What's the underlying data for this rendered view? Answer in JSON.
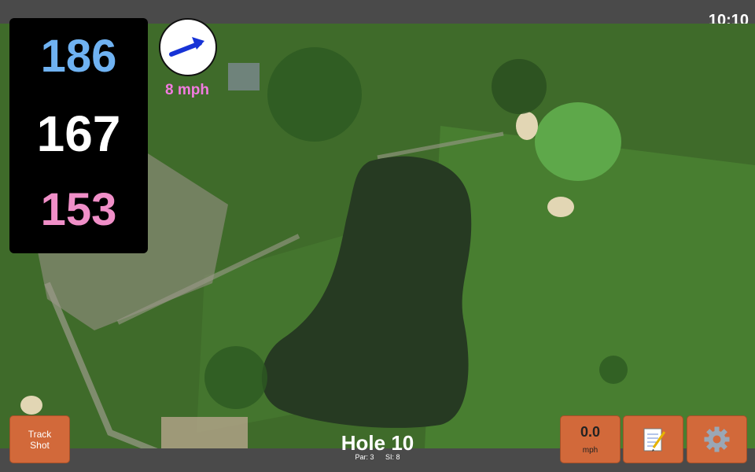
{
  "status": {
    "time": "10:10"
  },
  "distances": {
    "back": "186",
    "middle": "167",
    "front": "153"
  },
  "wind": {
    "speed": "8 mph",
    "direction_icon": "arrow-right-up-icon"
  },
  "hole": {
    "title": "Hole 10",
    "par": "Par: 3",
    "si": "SI: 8"
  },
  "buttons": {
    "track_shot": {
      "line1": "Track",
      "line2": "Shot"
    },
    "speed": {
      "value": "0.0",
      "unit": "mph"
    },
    "notes_icon": "notepad-icon",
    "settings_icon": "gear-icon"
  },
  "colors": {
    "back": "#6fb2f2",
    "middle": "#ffffff",
    "front": "#f08fc8",
    "wind_text": "#f27be0",
    "button": "#d2693a"
  }
}
